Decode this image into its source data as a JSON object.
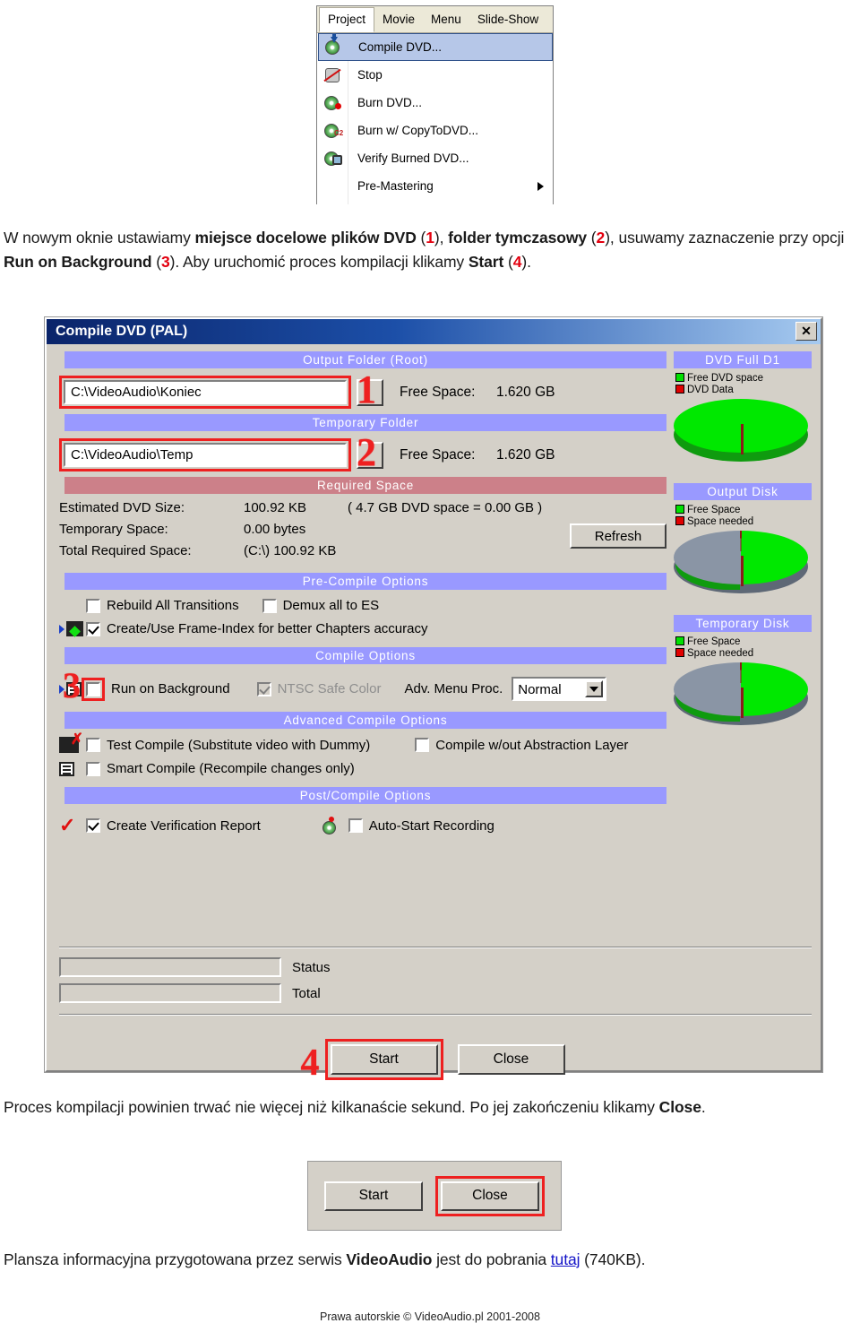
{
  "menu_screenshot": {
    "menubar": [
      {
        "label": "Project",
        "active": true
      },
      {
        "label": "Movie",
        "active": false
      },
      {
        "label": "Menu",
        "active": false
      },
      {
        "label": "Slide-Show",
        "active": false
      }
    ],
    "items": [
      {
        "label": "Compile DVD...",
        "icon": "disc-download-icon",
        "selected": true,
        "submenu": false
      },
      {
        "label": "Stop",
        "icon": "stop-hand-icon",
        "selected": false,
        "submenu": false
      },
      {
        "label": "Burn DVD...",
        "icon": "disc-burn-icon",
        "selected": false,
        "submenu": false
      },
      {
        "label": "Burn w/ CopyToDVD...",
        "icon": "disc-copyto-icon",
        "selected": false,
        "submenu": false
      },
      {
        "label": "Verify Burned DVD...",
        "icon": "disc-verify-icon",
        "selected": false,
        "submenu": false
      },
      {
        "label": "Pre-Mastering",
        "icon": "none",
        "selected": false,
        "submenu": true
      }
    ]
  },
  "paragraph1": {
    "seg1": "W nowym oknie ustawiamy ",
    "b1": "miejsce docelowe plików DVD",
    "n1": "1",
    "seg2": ", ",
    "b2": "folder tymczasowy",
    "n2": "2",
    "seg3": ", usuwamy zaznaczenie przy opcji ",
    "b3": "Run on Background",
    "n3": "3",
    "seg4": ". Aby uruchomić proces kompilacji klikamy ",
    "b4": "Start",
    "n4": "4",
    "seg5": "."
  },
  "dialog": {
    "title": "Compile DVD (PAL)",
    "close_label": "✕",
    "output_folder": {
      "header": "Output Folder (Root)",
      "path": "C:\\VideoAudio\\Koniec",
      "marker": "1",
      "free_space_label": "Free Space:",
      "free_space_value": "1.620 GB"
    },
    "temporary_folder": {
      "header": "Temporary Folder",
      "path": "C:\\VideoAudio\\Temp",
      "marker": "2",
      "free_space_label": "Free Space:",
      "free_space_value": "1.620 GB"
    },
    "required_space": {
      "header": "Required Space",
      "rows": [
        {
          "label": "Estimated DVD Size:",
          "value": "100.92 KB",
          "note": "( 4.7 GB DVD space = 0.00 GB )"
        },
        {
          "label": "Temporary Space:",
          "value": "0.00 bytes",
          "note": ""
        },
        {
          "label": "Total Required Space:",
          "value": "(C:\\) 100.92 KB",
          "note": ""
        }
      ],
      "refresh_label": "Refresh"
    },
    "pre_compile": {
      "header": "Pre-Compile Options",
      "rebuild_transitions": {
        "label": "Rebuild All Transitions",
        "checked": false
      },
      "demux_all": {
        "label": "Demux all to ES",
        "checked": false
      },
      "frame_index": {
        "label": "Create/Use Frame-Index for better Chapters accuracy",
        "checked": true
      }
    },
    "compile_options": {
      "header": "Compile Options",
      "marker": "3",
      "run_on_background": {
        "label": "Run on Background",
        "checked": false
      },
      "ntsc_safe_color": {
        "label": "NTSC Safe Color",
        "checked": true,
        "disabled": true
      },
      "adv_menu_proc_label": "Adv. Menu Proc.",
      "adv_menu_proc_value": "Normal"
    },
    "advanced_compile": {
      "header": "Advanced Compile Options",
      "test_compile": {
        "label": "Test Compile (Substitute video with Dummy)",
        "checked": false
      },
      "without_abstraction": {
        "label": "Compile w/out Abstraction Layer",
        "checked": false
      },
      "smart_compile": {
        "label": "Smart Compile (Recompile changes only)",
        "checked": false
      }
    },
    "post_compile": {
      "header": "Post/Compile Options",
      "verification_report": {
        "label": "Create Verification Report",
        "checked": true
      },
      "auto_start_recording": {
        "label": "Auto-Start Recording",
        "checked": false
      }
    },
    "status": {
      "status_label": "Status",
      "total_label": "Total"
    },
    "buttons": {
      "start": "Start",
      "close": "Close",
      "start_marker": "4"
    },
    "panels": {
      "dvd_full": {
        "header": "DVD Full D1",
        "legend": [
          {
            "label": "Free DVD space",
            "color": "#00e000"
          },
          {
            "label": "DVD Data",
            "color": "#e00000"
          }
        ]
      },
      "output_disk": {
        "header": "Output Disk",
        "legend": [
          {
            "label": "Free Space",
            "color": "#00e000"
          },
          {
            "label": "Space needed",
            "color": "#e00000"
          }
        ]
      },
      "temporary_disk": {
        "header": "Temporary Disk",
        "legend": [
          {
            "label": "Free Space",
            "color": "#00e000"
          },
          {
            "label": "Space needed",
            "color": "#e00000"
          }
        ]
      }
    }
  },
  "paragraph2": {
    "seg1": "Proces kompilacji powinien trwać nie więcej niż kilkanaście sekund. Po jej zakończeniu klikamy ",
    "b1": "Close",
    "seg2": "."
  },
  "mini_dialog": {
    "start_label": "Start",
    "close_label": "Close"
  },
  "paragraph3": {
    "seg1": "Plansza informacyjna przygotowana przez serwis ",
    "b1": "VideoAudio",
    "seg2": " jest do pobrania ",
    "link": "tutaj",
    "seg3": " (740KB)."
  },
  "copyright": "Prawa autorskie © VideoAudio.pl 2001-2008",
  "chart_data": [
    {
      "type": "pie",
      "title": "DVD Full D1",
      "categories": [
        "Free DVD space",
        "DVD Data"
      ],
      "values": [
        99.98,
        0.02
      ],
      "colors": [
        "#00e000",
        "#e00000"
      ],
      "legend": "top-left"
    },
    {
      "type": "pie",
      "title": "Output Disk",
      "categories": [
        "Free Space",
        "Space needed",
        "Used"
      ],
      "values": [
        45,
        0.5,
        54.5
      ],
      "colors": [
        "#00e000",
        "#e00000",
        "#8a95a5"
      ],
      "legend": "top-left"
    },
    {
      "type": "pie",
      "title": "Temporary Disk",
      "categories": [
        "Free Space",
        "Space needed",
        "Used"
      ],
      "values": [
        45,
        0.5,
        54.5
      ],
      "colors": [
        "#00e000",
        "#e00000",
        "#8a95a5"
      ],
      "legend": "top-left"
    }
  ]
}
